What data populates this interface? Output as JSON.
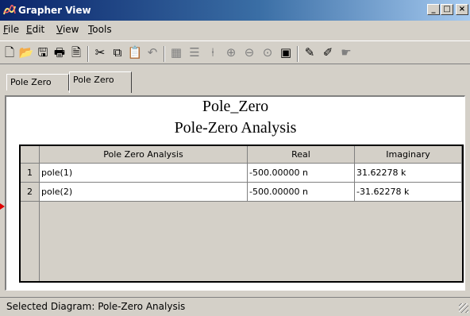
{
  "window": {
    "title": "Grapher View",
    "icon": "grapher-app-icon",
    "controls": [
      "_",
      "□",
      "×"
    ]
  },
  "menu": [
    {
      "accel": "F",
      "rest": "ile"
    },
    {
      "accel": "E",
      "rest": "dit"
    },
    {
      "accel": "V",
      "rest": "iew"
    },
    {
      "accel": "T",
      "rest": "ools"
    }
  ],
  "toolbar": {
    "icons": [
      "new-icon",
      "open-icon",
      "save-icon",
      "print-icon",
      "print-preview-icon",
      "cut-icon",
      "copy-icon",
      "paste-icon",
      "undo-icon",
      "grid-icon",
      "list-icon",
      "axis-icon",
      "zoom-in-icon",
      "zoom-out-icon",
      "zoom-fit-icon",
      "window-icon",
      "tag-icon",
      "edit-tag-icon",
      "pointer-icon"
    ],
    "glyphs": [
      "🗋",
      "📂",
      "🖫",
      "🖶",
      "🗎",
      "✂",
      "⧉",
      "📋",
      "↶",
      "▦",
      "☰",
      "⍿",
      "⊕",
      "⊖",
      "⊙",
      "▣",
      "✎",
      "✐",
      "☛"
    ]
  },
  "tabs": [
    "Pole Zero",
    "Pole Zero"
  ],
  "panel": {
    "title": "Pole_Zero",
    "subtitle": "Pole-Zero Analysis"
  },
  "table": {
    "headers": [
      "Pole Zero Analysis",
      "Real",
      "Imaginary"
    ],
    "rows": [
      {
        "num": "1",
        "name": "pole(1)",
        "real": "-500.00000 n",
        "imag": "31.62278 k"
      },
      {
        "num": "2",
        "name": "pole(2)",
        "real": "-500.00000 n",
        "imag": "-31.62278 k"
      }
    ]
  },
  "status": {
    "text": "Selected Diagram:  Pole-Zero Analysis"
  }
}
